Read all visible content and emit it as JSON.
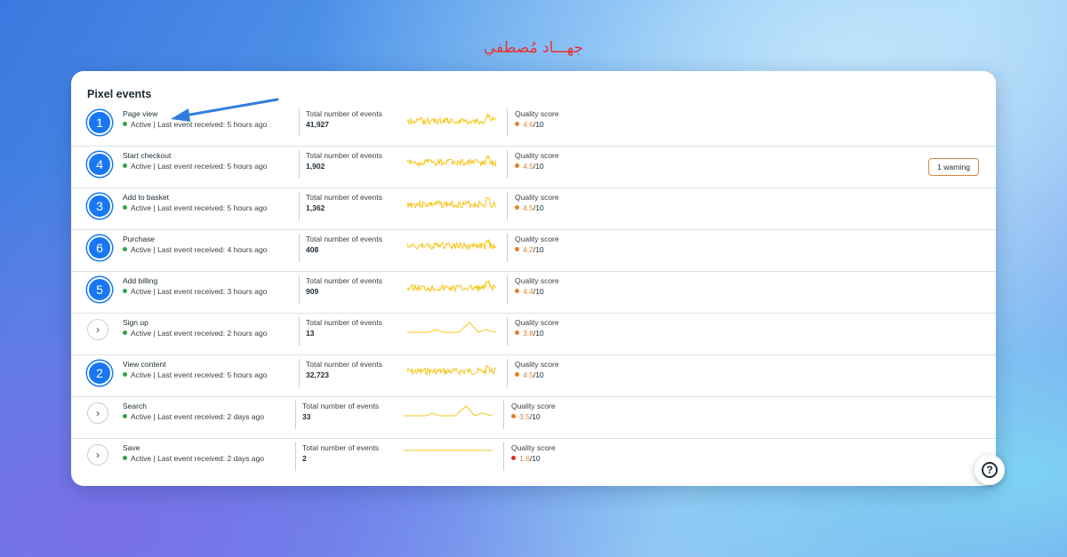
{
  "watermark": "جهـــاد مُصطفي",
  "card": {
    "title": "Pixel events"
  },
  "labels": {
    "total": "Total number of events",
    "quality": "Quality score"
  },
  "colors": {
    "accent": "#1877f2",
    "active": "#31a24c",
    "quality_mid": "#e0822a",
    "quality_low": "#d93025",
    "spark": "#f5c518"
  },
  "events": [
    {
      "name": "Page view",
      "badge": "1",
      "status": "Active | Last event received: 5 hours ago",
      "total": "41,927",
      "quality": "4.6",
      "quality_max": "/10",
      "quality_level": "mid",
      "spark": "dense"
    },
    {
      "name": "Start checkout",
      "badge": "4",
      "status": "Active | Last event received: 5 hours ago",
      "total": "1,902",
      "quality": "4.5",
      "quality_max": "/10",
      "quality_level": "mid",
      "spark": "dense",
      "warning": "1 warning"
    },
    {
      "name": "Add to basket",
      "badge": "3",
      "status": "Active | Last event received: 5 hours ago",
      "total": "1,362",
      "quality": "4.5",
      "quality_max": "/10",
      "quality_level": "mid",
      "spark": "dense"
    },
    {
      "name": "Purchase",
      "badge": "6",
      "status": "Active | Last event received: 4 hours ago",
      "total": "408",
      "quality": "4.2",
      "quality_max": "/10",
      "quality_level": "mid",
      "spark": "dense"
    },
    {
      "name": "Add billing",
      "badge": "5",
      "status": "Active | Last event received: 3 hours ago",
      "total": "909",
      "quality": "4.4",
      "quality_max": "/10",
      "quality_level": "mid",
      "spark": "dense"
    },
    {
      "name": "Sign up",
      "badge": "",
      "status": "Active | Last event received: 2 hours ago",
      "total": "13",
      "quality": "3.8",
      "quality_max": "/10",
      "quality_level": "mid",
      "spark": "sparse"
    },
    {
      "name": "View content",
      "badge": "2",
      "status": "Active | Last event received: 5 hours ago",
      "total": "32,723",
      "quality": "4.5",
      "quality_max": "/10",
      "quality_level": "mid",
      "spark": "dense"
    },
    {
      "name": "Search",
      "badge": "",
      "status": "Active | Last event received: 2 days ago",
      "total": "33",
      "quality": "3.5",
      "quality_max": "/10",
      "quality_level": "mid",
      "spark": "sparse"
    },
    {
      "name": "Save",
      "badge": "",
      "status": "Active | Last event received: 2 days ago",
      "total": "2",
      "quality": "1.6",
      "quality_max": "/10",
      "quality_level": "low",
      "spark": "flat"
    }
  ]
}
